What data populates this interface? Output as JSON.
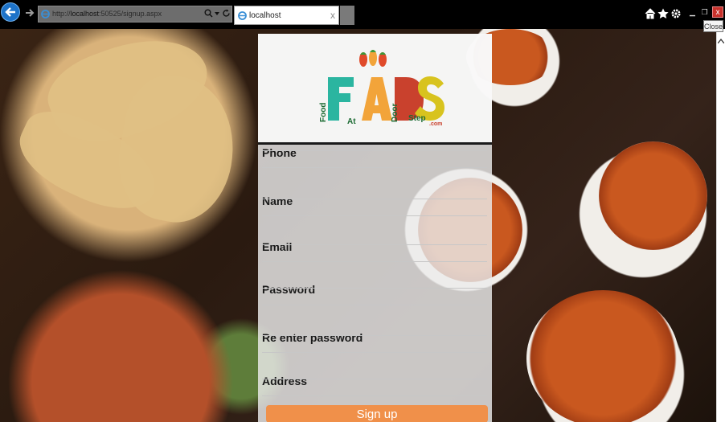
{
  "browser": {
    "url_prefix": "http://",
    "url_host": "localhost",
    "url_rest": ":50525/signup.aspx",
    "tab_title": "localhost",
    "tab_close": "x",
    "close_tooltip": "Close",
    "close_glyph": "x"
  },
  "logo": {
    "letters": [
      "F",
      "A",
      "D",
      "S"
    ],
    "words": [
      "Food",
      "At",
      "Door",
      "Step"
    ],
    "suffix": ".com",
    "colors": {
      "F": "#2bb5a0",
      "A": "#f2a43a",
      "D": "#c9412d",
      "S": "#d8c31e"
    }
  },
  "form": {
    "fields": [
      {
        "label": "Phone",
        "value": ""
      },
      {
        "label": "Name",
        "value": ""
      },
      {
        "label": "Email",
        "value": ""
      },
      {
        "label": "Password",
        "value": ""
      },
      {
        "label": "Re enter password",
        "value": ""
      },
      {
        "label": "Address",
        "value": ""
      }
    ],
    "submit_label": "Sign up"
  },
  "colors": {
    "button_orange": "#f0904a",
    "panel": "#ebebeb"
  }
}
